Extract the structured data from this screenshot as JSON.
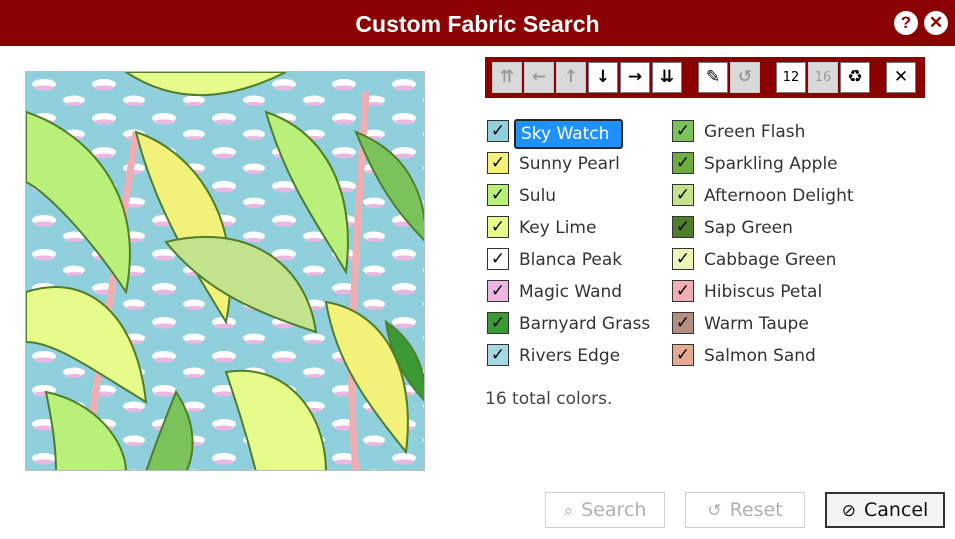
{
  "dialog": {
    "title": "Custom Fabric Search",
    "help_icon": "?",
    "close_icon": "✕"
  },
  "colors_hex": {
    "titlebar": "#8b0000",
    "selected": "#1e90ff"
  },
  "toolbar": {
    "buttons": [
      {
        "icon": "double-up-icon",
        "glyph": "⇈",
        "enabled": false
      },
      {
        "icon": "arrow-left-icon",
        "glyph": "←",
        "enabled": false
      },
      {
        "icon": "arrow-up-icon",
        "glyph": "↑",
        "enabled": false
      },
      {
        "icon": "arrow-down-icon",
        "glyph": "↓",
        "enabled": true
      },
      {
        "icon": "arrow-right-icon",
        "glyph": "→",
        "enabled": true
      },
      {
        "icon": "double-down-icon",
        "glyph": "⇊",
        "enabled": true
      },
      {
        "icon": "pencil-icon",
        "glyph": "✎",
        "enabled": true
      },
      {
        "icon": "undo-icon",
        "glyph": "↺",
        "enabled": false
      },
      {
        "icon": "count-12",
        "glyph": "12",
        "enabled": true
      },
      {
        "icon": "count-16",
        "glyph": "16",
        "enabled": false
      },
      {
        "icon": "recycle-icon",
        "glyph": "♻",
        "enabled": true
      },
      {
        "icon": "close-icon",
        "glyph": "✕",
        "enabled": true
      }
    ]
  },
  "fabric_colors": {
    "left": [
      {
        "name": "Sky Watch",
        "hex": "#8fd0dc",
        "checked": true,
        "selected": true
      },
      {
        "name": "Sunny Pearl",
        "hex": "#f2f17a",
        "checked": true
      },
      {
        "name": "Sulu",
        "hex": "#b9f07a",
        "checked": true
      },
      {
        "name": "Key Lime",
        "hex": "#e6fb8a",
        "checked": true
      },
      {
        "name": "Blanca Peak",
        "hex": "#ffffff",
        "checked": true
      },
      {
        "name": "Magic Wand",
        "hex": "#eab6e2",
        "checked": true
      },
      {
        "name": "Barnyard Grass",
        "hex": "#3c9a36",
        "checked": true
      },
      {
        "name": "Rivers Edge",
        "hex": "#a6d8df",
        "checked": true
      }
    ],
    "right": [
      {
        "name": "Green Flash",
        "hex": "#7bc25a",
        "checked": true
      },
      {
        "name": "Sparkling Apple",
        "hex": "#6fae3e",
        "checked": true
      },
      {
        "name": "Afternoon Delight",
        "hex": "#c3e28c",
        "checked": true
      },
      {
        "name": "Sap Green",
        "hex": "#4e7d2b",
        "checked": true
      },
      {
        "name": "Cabbage Green",
        "hex": "#eef4b6",
        "checked": true
      },
      {
        "name": "Hibiscus Petal",
        "hex": "#f0aeb2",
        "checked": true
      },
      {
        "name": "Warm Taupe",
        "hex": "#b38e81",
        "checked": true
      },
      {
        "name": "Salmon Sand",
        "hex": "#e5ab91",
        "checked": true
      }
    ]
  },
  "check_glyph": "✓",
  "total_text": "16 total colors.",
  "buttons": {
    "search": {
      "label": "Search",
      "icon": "search-icon",
      "glyph": "⌕"
    },
    "reset": {
      "label": "Reset",
      "icon": "undo-icon",
      "glyph": "↺"
    },
    "cancel": {
      "label": "Cancel",
      "icon": "cancel-icon",
      "glyph": "⊘"
    }
  }
}
